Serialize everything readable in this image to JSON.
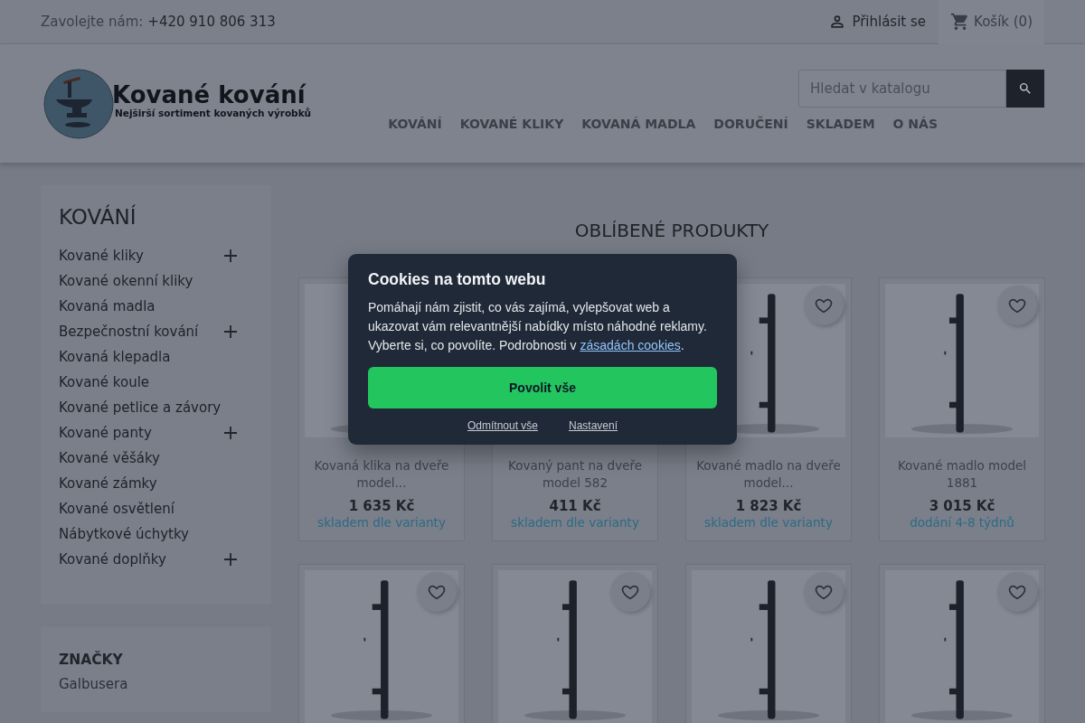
{
  "topbar": {
    "contact_label": "Zavolejte nám:",
    "phone": "+420 910 806 313",
    "login": "Přihlásit se",
    "cart": "Košík (0)"
  },
  "logo": {
    "title": "Kované kování",
    "subtitle": "Nejširší sortiment kovaných výrobků"
  },
  "search": {
    "placeholder": "Hledat v katalogu"
  },
  "nav": [
    "KOVÁNÍ",
    "KOVANÉ KLIKY",
    "KOVANÁ MADLA",
    "DORUČENÍ",
    "SKLADEM",
    "O NÁS"
  ],
  "sidebar": {
    "title": "KOVÁNÍ",
    "items": [
      {
        "label": "Kované kliky",
        "expandable": true
      },
      {
        "label": "Kované okenní kliky",
        "expandable": false
      },
      {
        "label": "Kovaná madla",
        "expandable": false
      },
      {
        "label": "Bezpečnostní kování",
        "expandable": true
      },
      {
        "label": "Kovaná klepadla",
        "expandable": false
      },
      {
        "label": "Kované koule",
        "expandable": false
      },
      {
        "label": "Kované petlice a závory",
        "expandable": false
      },
      {
        "label": "Kované panty",
        "expandable": true
      },
      {
        "label": "Kované věšáky",
        "expandable": false
      },
      {
        "label": "Kované zámky",
        "expandable": false
      },
      {
        "label": "Kované osvětlení",
        "expandable": false
      },
      {
        "label": "Nábytkové úchytky",
        "expandable": false
      },
      {
        "label": "Kované doplňky",
        "expandable": true
      }
    ]
  },
  "brands": {
    "title": "ZNAČKY",
    "items": [
      "Galbusera"
    ]
  },
  "section_title": "OBLÍBENÉ PRODUKTY",
  "products": [
    {
      "title": "Kovaná klika na dveře model...",
      "price": "1 635 Kč",
      "availability": "skladem dle varianty",
      "image": true,
      "wishlist_button": false
    },
    {
      "title": "Kovaný pant na dveře model 582",
      "price": "411 Kč",
      "availability": "skladem dle varianty",
      "image": false,
      "wishlist_button": false
    },
    {
      "title": "Kované madlo na dveře model...",
      "price": "1 823 Kč",
      "availability": "skladem dle varianty",
      "image": true,
      "wishlist_button": true
    },
    {
      "title": "Kované madlo model 1881",
      "price": "3 015 Kč",
      "availability": "dodání 4-8 týdnů",
      "image": true,
      "wishlist_button": true
    },
    {
      "image": true,
      "wishlist_button": true
    },
    {
      "image": true,
      "wishlist_button": true
    },
    {
      "image": true,
      "wishlist_button": true
    },
    {
      "image": true,
      "wishlist_button": true
    }
  ],
  "cookie_dialog": {
    "title": "Cookies na tomto webu",
    "text": "Pomáhají nám zjistit, co vás zajímá, vylepšovat web a ukazovat vám relevantnější nabídky místo náhodné reklamy. Vyberte si, co povolíte. Podrobnosti v",
    "link": "zásadách cookies",
    "text_end": ".",
    "accept": "Povolit vše",
    "reject": "Odmítnout vše",
    "settings": "Nastavení"
  }
}
